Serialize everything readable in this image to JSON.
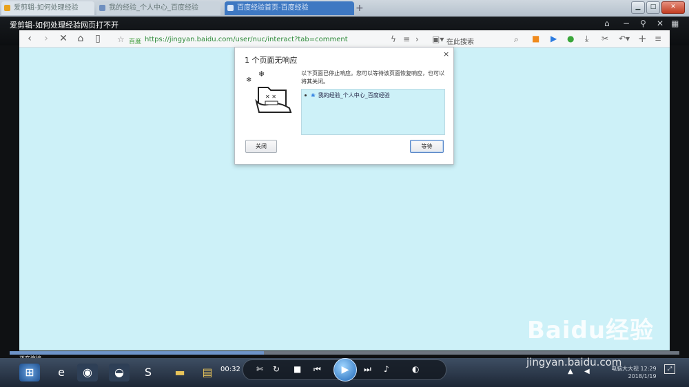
{
  "tabs": [
    {
      "label": "爱剪辑-如何处理经验"
    },
    {
      "label": "我的经验_个人中心_百度经验"
    },
    {
      "label": "百度经验首页-百度经验"
    }
  ],
  "window": {
    "new_tab": "+",
    "minimize": "▁",
    "maximize": "□",
    "close": "✕"
  },
  "player": {
    "title": "爱剪辑-如何处理经验网页打不开",
    "status": "正在连接...",
    "time": "00:32",
    "progress_fraction": 0.38
  },
  "toolbar": {
    "site_label": "百度",
    "url": "https://jingyan.baidu.com/user/nuc/interact?tab=comment",
    "search_placeholder": "在此搜索"
  },
  "dialog": {
    "title": "1 个页面无响应",
    "close": "×",
    "message": "以下页面已停止响应。您可以等待该页面恢复响应，也可以将其关闭。",
    "list_item": "我的经验_个人中心_百度经验",
    "close_button": "关闭",
    "wait_button": "等待"
  },
  "clock": {
    "line1": "电脑大大视 12:29",
    "line2": "2018/1/19"
  },
  "watermark": {
    "logo": "Baidu经验",
    "url": "jingyan.baidu.com"
  },
  "colors": {
    "page_bg": "#cdf1f8",
    "accent": "#2e8b3a",
    "progress": "#6e94c9"
  }
}
